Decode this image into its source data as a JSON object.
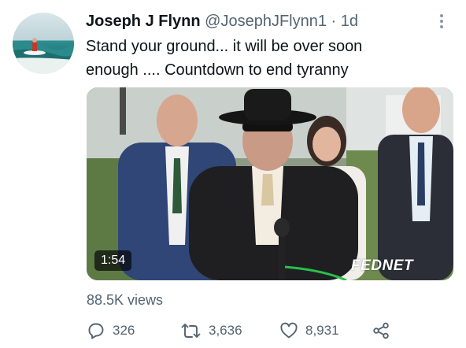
{
  "author": {
    "name": "Joseph J Flynn",
    "handle": "@JosephJFlynn1",
    "separator": "·",
    "time": "1d",
    "avatar_icon": "surfer-avatar"
  },
  "tweet": {
    "lines": [
      "Stand your ground... it will be over soon",
      "enough .... Countdown to end tyranny"
    ]
  },
  "media": {
    "duration": "1:54",
    "watermark": "FEDNET"
  },
  "stats": {
    "views": "88.5K views",
    "replies": "326",
    "retweets": "3,636",
    "likes": "8,931"
  },
  "icons": {
    "reply": "reply-icon",
    "retweet": "retweet-icon",
    "like": "heart-icon",
    "share": "share-icon",
    "more": "more-icon"
  },
  "colors": {
    "text": "#0f1419",
    "secondary": "#536471"
  }
}
